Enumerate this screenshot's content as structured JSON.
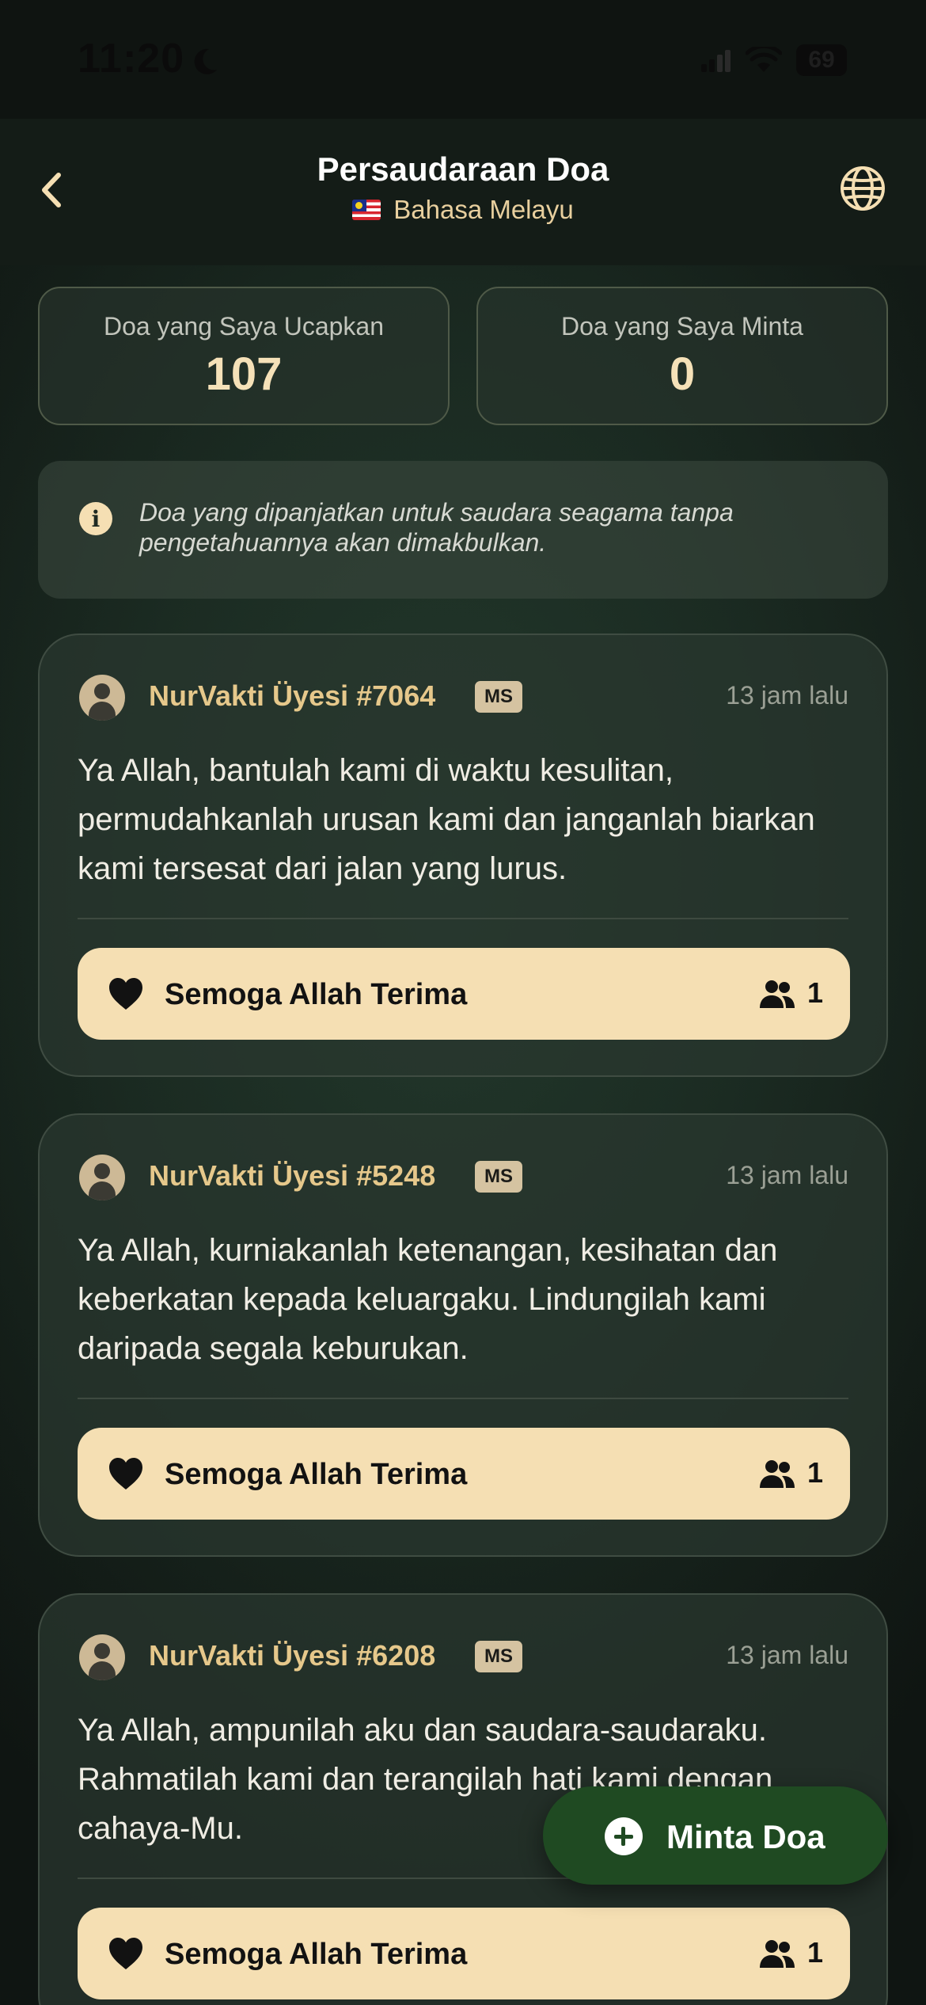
{
  "status_bar": {
    "time": "11:20",
    "battery": "69"
  },
  "header": {
    "title": "Persaudaraan Doa",
    "language": "Bahasa Melayu",
    "back_icon": "chevron-left-icon",
    "language_icon": "globe-icon"
  },
  "stats": {
    "said": {
      "label": "Doa yang Saya Ucapkan",
      "value": "107"
    },
    "requested": {
      "label": "Doa yang Saya Minta",
      "value": "0"
    }
  },
  "info": {
    "icon": "info-icon",
    "text": "Doa yang dipanjatkan untuk saudara seagama tanpa pengetahuannya akan dimakbulkan."
  },
  "prayers": [
    {
      "user": "NurVakti Üyesi #7064",
      "lang": "MS",
      "time": "13 jam lalu",
      "text": "Ya Allah, bantulah kami di waktu kesulitan, permudahkanlah urusan kami dan janganlah biarkan kami tersesat dari jalan yang lurus.",
      "button_label": "Semoga Allah Terima",
      "count": "1"
    },
    {
      "user": "NurVakti Üyesi #5248",
      "lang": "MS",
      "time": "13 jam lalu",
      "text": "Ya Allah, kurniakanlah ketenangan, kesihatan dan keberkatan kepada keluargaku. Lindungilah kami daripada segala keburukan.",
      "button_label": "Semoga Allah Terima",
      "count": "1"
    },
    {
      "user": "NurVakti Üyesi #6208",
      "lang": "MS",
      "time": "13 jam lalu",
      "text": "Ya Allah, ampunilah aku dan saudara-saudaraku. Rahmatilah kami dan terangilah hati kami dengan cahaya-Mu.",
      "button_label": "Semoga Allah Terima",
      "count": "1"
    }
  ],
  "fab": {
    "label": "Minta Doa",
    "icon": "plus-circle-icon"
  },
  "colors": {
    "accent": "#f5dfb3",
    "gold_text": "#e6c88b",
    "fab": "#1f4a22",
    "background": "#1b2b22"
  }
}
